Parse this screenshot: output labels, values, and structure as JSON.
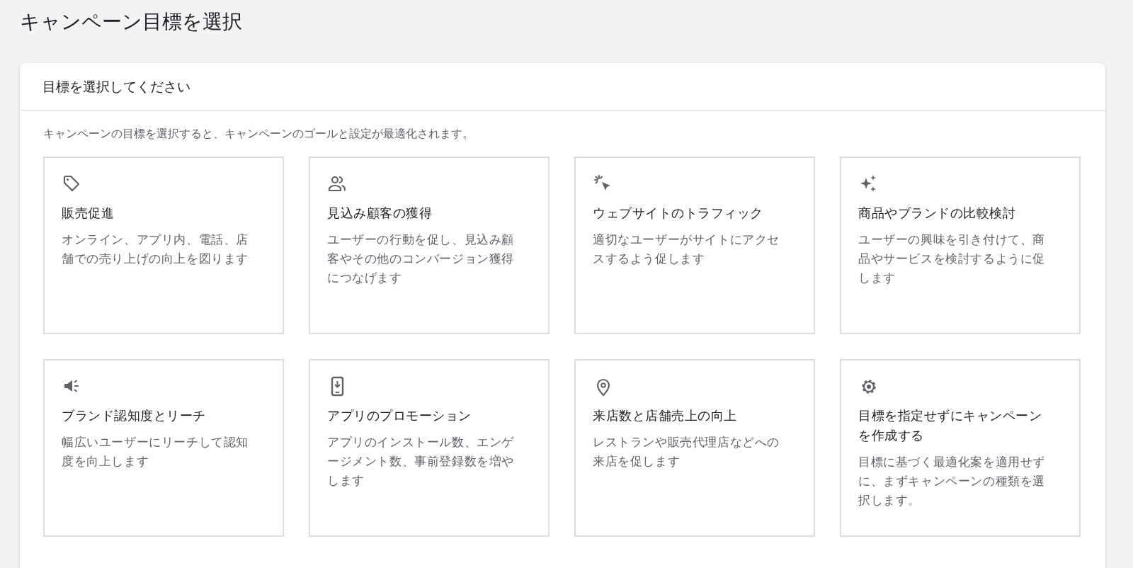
{
  "page_title": "キャンペーン目標を選択",
  "panel": {
    "heading": "目標を選択してください",
    "intro": "キャンペーンの目標を選択すると、キャンペーンのゴールと設定が最適化されます。",
    "goals": [
      {
        "title": "販売促進",
        "description": "オンライン、アプリ内、電話、店舗での売り上げの向上を図ります",
        "selected": false
      },
      {
        "title": "見込み顧客の獲得",
        "description": "ユーザーの行動を促し、見込み顧客やその他のコンバージョン獲得につなげます",
        "selected": false
      },
      {
        "title": "ウェブサイトのトラフィック",
        "description": "適切なユーザーがサイトにアクセスするよう促します",
        "selected": false
      },
      {
        "title": "商品やブランドの比較検討",
        "description": "ユーザーの興味を引き付けて、商品やサービスを検討するように促します",
        "selected": false
      },
      {
        "title": "ブランド認知度とリーチ",
        "description": "幅広いユーザーにリーチして認知度を向上します",
        "selected": false
      },
      {
        "title": "アプリのプロモーション",
        "description": "アプリのインストール数、エンゲージメント数、事前登録数を増やします",
        "selected": false
      },
      {
        "title": "来店数と店舗売上の向上",
        "description": "レストランや販売代理店などへの来店を促します",
        "selected": false
      },
      {
        "title": "目標を指定せずにキャンペーンを作成する",
        "description": "目標に基づく最適化案を適用せずに、まずキャンペーンの種類を選択します。",
        "selected": false
      }
    ]
  }
}
